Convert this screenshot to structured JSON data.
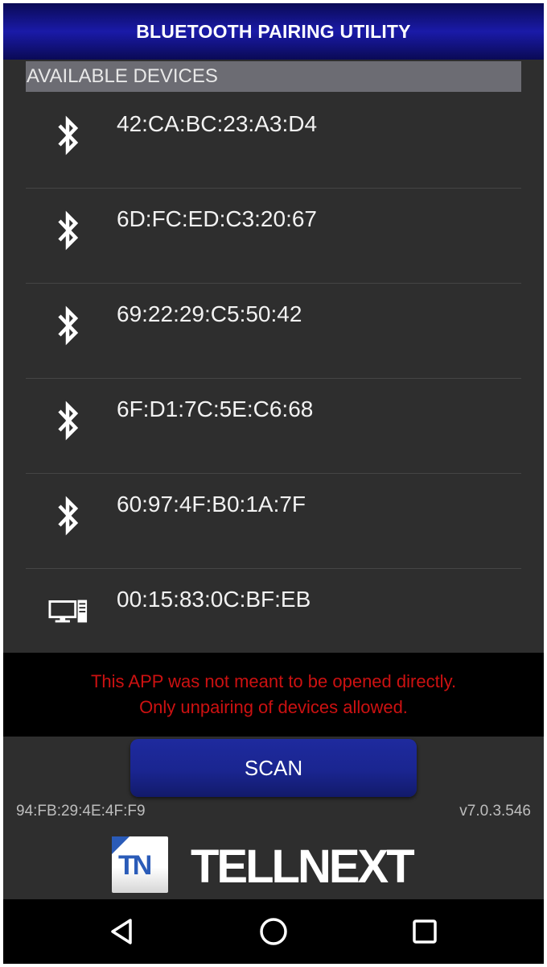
{
  "title": "BLUETOOTH PAIRING UTILITY",
  "section_header": "AVAILABLE DEVICES",
  "devices": [
    {
      "mac": "42:CA:BC:23:A3:D4",
      "icon": "bluetooth-icon"
    },
    {
      "mac": "6D:FC:ED:C3:20:67",
      "icon": "bluetooth-icon"
    },
    {
      "mac": "69:22:29:C5:50:42",
      "icon": "bluetooth-icon"
    },
    {
      "mac": "6F:D1:7C:5E:C6:68",
      "icon": "bluetooth-icon"
    },
    {
      "mac": "60:97:4F:B0:1A:7F",
      "icon": "bluetooth-icon"
    },
    {
      "mac": "00:15:83:0C:BF:EB",
      "icon": "computer-icon"
    }
  ],
  "warning": {
    "line1": "This APP was not meant to be opened directly.",
    "line2": "Only unpairing of devices allowed."
  },
  "scan_button": "SCAN",
  "own_mac": "94:FB:29:4E:4F:F9",
  "version": "v7.0.3.546",
  "logo": {
    "mark": "TN",
    "word": "TELLNEXT"
  },
  "nav": {
    "back": "back-icon",
    "home": "home-icon",
    "recents": "recents-icon"
  },
  "colors": {
    "title_bar": "#1a1aa8",
    "background": "#2e2e2e",
    "warning_text": "#cc1111",
    "scan_button": "#1a2590"
  }
}
